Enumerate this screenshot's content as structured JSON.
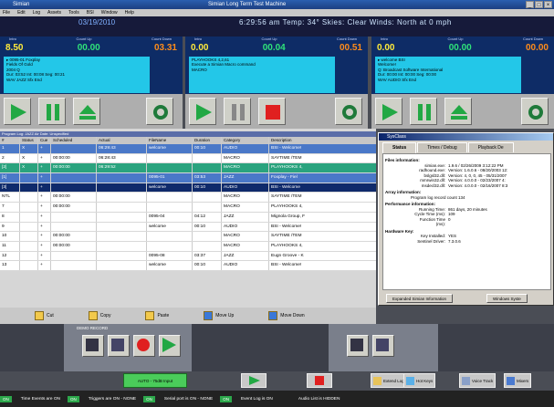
{
  "window": {
    "app_title": "Simian",
    "title": "Simian Long Term Test Machine",
    "controls": [
      "_",
      "□",
      "×"
    ]
  },
  "menu": [
    "File",
    "Edit",
    "Log",
    "Assets",
    "Tools",
    "BSI",
    "Window",
    "Help"
  ],
  "status": {
    "date": "03/19/2010",
    "line": "6:29:56 am   Temp: 34°   Skies: Clear   Winds: North at 0 mph"
  },
  "decks": [
    {
      "intro_label": "Intro",
      "countup_label": "Count Up",
      "countdown_label": "Count Down",
      "intro": "8.50",
      "countup": "00.00",
      "countdown": "03.31",
      "info": [
        "▸ 0095-01  Foxplay",
        "Fields Of Gold",
        "2004  Q",
        "Dur: 03:52   Int: 00:08   Seg: 00:21",
        "WAV   JAZZ      Sfx              End"
      ]
    },
    {
      "intro_label": "Intro",
      "countup_label": "Count Up",
      "countdown_label": "Count Down",
      "intro": "0.00",
      "countup": "00.04",
      "countdown": "00.51",
      "info": [
        "",
        "PLAYHOOKS 4,2,61",
        "Execute a Simian Macro command",
        "",
        "MACRO"
      ]
    },
    {
      "intro_label": "Intro",
      "countup_label": "Count Up",
      "countdown_label": "Count Down",
      "intro": "0.00",
      "countup": "00.00",
      "countdown": "00.00",
      "info": [
        "▸ welcome  BSI",
        "Welcome!",
        "Q: Broadcast Software International",
        "Dur: 00:00   Int: 00:00   Seg: 00:00",
        "WAV   AUDIO    Sfx              End"
      ]
    }
  ],
  "grid": {
    "header": "Program Log: JAZZ     Air Date: Unspecified",
    "columns": [
      "#",
      "Status",
      "Cue",
      "Scheduled",
      "Actual",
      "FileName",
      "Duration",
      "Category",
      "Description"
    ],
    "rows": [
      {
        "style": "blue",
        "cells": [
          "1",
          "X",
          "+",
          "",
          "06:29:43",
          "welcome",
          "00:10",
          "AUDIO",
          "BSI - Welcome!"
        ]
      },
      {
        "style": "white",
        "cells": [
          "2",
          "X",
          "+",
          "00:00:00",
          "06:28:43",
          "",
          "",
          "MACRO",
          "SAYTIME /TEM"
        ]
      },
      {
        "style": "teal",
        "cells": [
          "[2]",
          "X",
          "+",
          "00:00:00",
          "06:29:52",
          "",
          "",
          "MACRO",
          "PLAYHOOKS 4,"
        ]
      },
      {
        "style": "blue",
        "cells": [
          "[1]",
          "",
          "+",
          "",
          "",
          "0095-01",
          "03:53",
          "JAZZ",
          "Foxplay - Fiel"
        ]
      },
      {
        "style": "navy",
        "cells": [
          "[3]",
          "",
          "+",
          "",
          "",
          "welcome",
          "00:10",
          "AUDIO",
          "BSI - Welcome"
        ]
      },
      {
        "style": "white",
        "cells": [
          "NTL",
          "",
          "+",
          "00:00:00",
          "",
          "",
          "",
          "MACRO",
          "SAYTIME /TEM"
        ]
      },
      {
        "style": "white",
        "cells": [
          "7",
          "",
          "+",
          "00:00:00",
          "",
          "",
          "",
          "MACRO",
          "PLAYHOOKS 4,"
        ]
      },
      {
        "style": "white",
        "cells": [
          "8",
          "",
          "+",
          "",
          "",
          "0095-04",
          "04:12",
          "JAZZ",
          "Mignola Group, F"
        ]
      },
      {
        "style": "white",
        "cells": [
          "9",
          "",
          "+",
          "",
          "",
          "welcome",
          "00:10",
          "AUDIO",
          "BSI - Welcome!"
        ]
      },
      {
        "style": "white",
        "cells": [
          "10",
          "",
          "+",
          "00:00:00",
          "",
          "",
          "",
          "MACRO",
          "SAYTIME /TEM"
        ]
      },
      {
        "style": "white",
        "cells": [
          "11",
          "",
          "+",
          "00:00:00",
          "",
          "",
          "",
          "MACRO",
          "PLAYHOOKS 4,"
        ]
      },
      {
        "style": "white",
        "cells": [
          "12",
          "",
          "+",
          "",
          "",
          "0095-08",
          "03:37",
          "JAZZ",
          "Eugn Groove - K"
        ]
      },
      {
        "style": "white",
        "cells": [
          "13",
          "",
          "+",
          "",
          "",
          "welcome",
          "00:10",
          "AUDIO",
          "BSI - Welcome!"
        ]
      }
    ]
  },
  "edit_buttons": [
    "Cut",
    "Copy",
    "Paste",
    "Move Up",
    "Move Down"
  ],
  "demo_deck": {
    "label": "DEMO RECORD"
  },
  "bottom": {
    "auto_label": "AUTO - 75dB Input",
    "extend_log": "Extend Log",
    "hot_keys": "Hot Keys",
    "voice_track": "Voice Track",
    "mixers": "Mixers"
  },
  "statusbar": [
    {
      "tag": "ON",
      "text": "Time Events are ON"
    },
    {
      "tag": "ON",
      "text": "Triggers are ON - NONE"
    },
    {
      "tag": "ON",
      "text": "Serial port is ON - NONE"
    },
    {
      "tag": "ON",
      "text": "Event Log is ON"
    },
    {
      "tag": "",
      "text": "Audio List is HIDDEN"
    }
  ],
  "dialog": {
    "title": "SysClass",
    "tabs": [
      "Status",
      "Times / Debug",
      "Playback De"
    ],
    "files_label": "Files information:",
    "files": [
      {
        "k": "simian.exe:",
        "v": "1.9.6 / 02/26/2009 3:12:22 PM"
      },
      {
        "k": "radhound.exe:",
        "v": "Version: 1.6.0.6 - 08/20/2003 12:"
      },
      {
        "k": "bslgsl32.dll:",
        "v": "Version: 4, 0, 0, 45 - 05/31/2007"
      },
      {
        "k": "mmrwin32.dll:",
        "v": "Version: 4.0.0.0 - 02/23/2007 4:"
      },
      {
        "k": "msdecl32.dll:",
        "v": "Version: 4.0.0.0 - 02/16/2007 8:3"
      }
    ],
    "array_label": "Array information:",
    "array_text": "Program log record count 134",
    "perf_label": "Performance information:",
    "perf": [
      {
        "k": "Running Time:",
        "v": "861 days, 20 minutes"
      },
      {
        "k": "Cycle Time (ms):",
        "v": "109"
      },
      {
        "k": "Function Time (ms):",
        "v": "0"
      }
    ],
    "hw_label": "Hardware Key:",
    "hw": [
      {
        "k": "Key Installed:",
        "v": "YES"
      },
      {
        "k": "Sentinel Driver:",
        "v": "7.3.0.6"
      }
    ],
    "button_expand": "Expanded Simian Information",
    "button_windows": "Windows Syste"
  }
}
